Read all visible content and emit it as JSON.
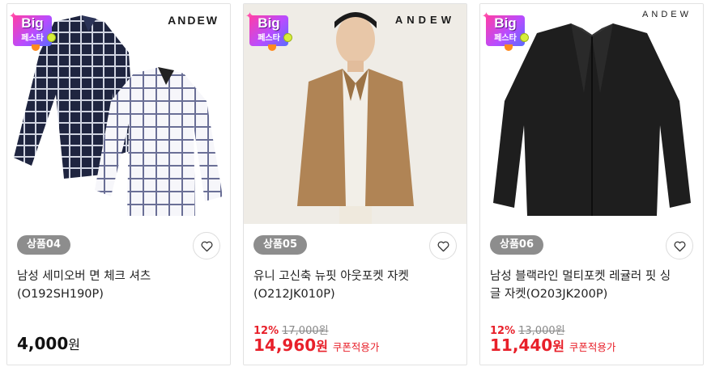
{
  "products": [
    {
      "brand": "ANDEW",
      "badge": {
        "title": "Big",
        "subtitle": "페스타"
      },
      "tag": "상품04",
      "title": "남성 세미오버 면 체크 셔츠(O192SH190P)",
      "price": "4,000",
      "currency": "원"
    },
    {
      "brand": "ANDEW",
      "badge": {
        "title": "Big",
        "subtitle": "페스타"
      },
      "tag": "상품05",
      "title": "유니 고신축 뉴핏 아웃포켓 자켓(O212JK010P)",
      "discount_rate": "12%",
      "original_price": "17,000원",
      "price": "14,960",
      "currency": "원",
      "coupon_label": "쿠폰적용가"
    },
    {
      "brand": "ANDEW",
      "badge": {
        "title": "Big",
        "subtitle": "페스타"
      },
      "tag": "상품06",
      "title": "남성 블랙라인 멀티포켓 레귤러 핏 싱글 자켓(O203JK200P)",
      "discount_rate": "12%",
      "original_price": "13,000원",
      "price": "11,440",
      "currency": "원",
      "coupon_label": "쿠폰적용가"
    }
  ],
  "colors": {
    "sale_red": "#e8202a",
    "tag_gray": "#8d8d8d"
  },
  "icons": {
    "wishlist": "heart-outline-icon"
  }
}
